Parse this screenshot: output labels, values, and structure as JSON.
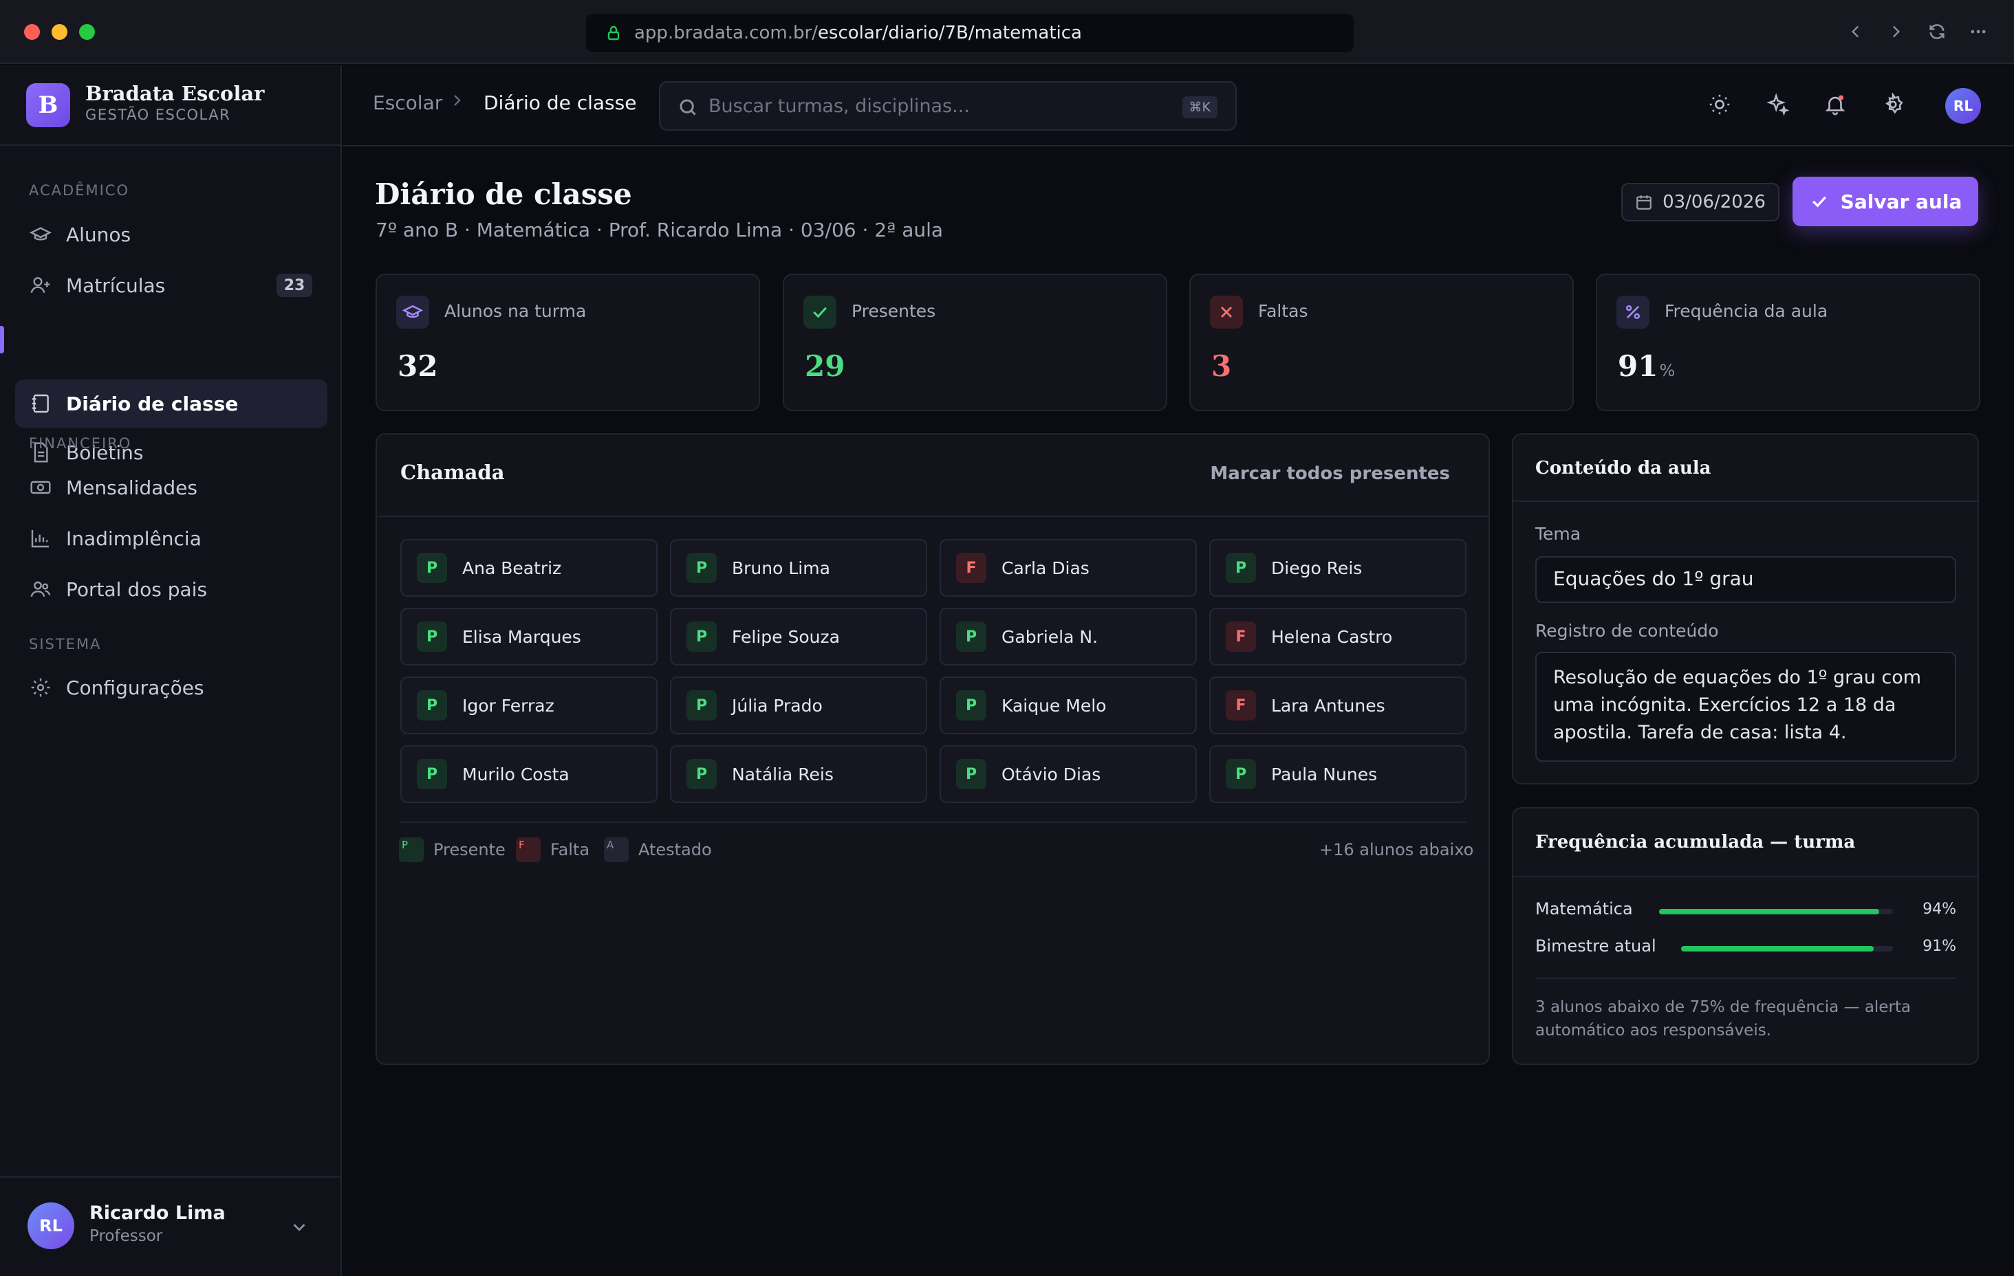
{
  "browser": {
    "url_host": "app.bradata.com.br/",
    "url_path": "escolar/diario/7B/matematica"
  },
  "sidebar": {
    "brand_letter": "B",
    "brand_name": "Bradata Escolar",
    "brand_sub": "GESTÃO ESCOLAR",
    "sections": {
      "academico": "ACADÊMICO",
      "financeiro": "FINANCEIRO",
      "sistema": "SISTEMA"
    },
    "items": {
      "alunos": "Alunos",
      "matriculas": "Matrículas",
      "matriculas_badge": "23",
      "diario": "Diário de classe",
      "boletins": "Boletins",
      "mensalidades": "Mensalidades",
      "inadimplencia": "Inadimplência",
      "portal": "Portal dos pais",
      "configuracoes": "Configurações"
    },
    "user": {
      "initials": "RL",
      "name": "Ricardo Lima",
      "role": "Professor"
    }
  },
  "topbar": {
    "breadcrumb_root": "Escolar",
    "breadcrumb_current": "Diário de classe",
    "search_placeholder": "Buscar turmas, disciplinas...",
    "search_shortcut": "⌘K",
    "avatar_initials": "RL"
  },
  "header": {
    "title": "Diário de classe",
    "subtitle": "7º ano B · Matemática · Prof. Ricardo Lima · 03/06 · 2ª aula",
    "date": "03/06/2026",
    "save_label": "Salvar aula"
  },
  "stats": {
    "alunos": {
      "label": "Alunos na turma",
      "value": "32"
    },
    "presentes": {
      "label": "Presentes",
      "value": "29"
    },
    "faltas": {
      "label": "Faltas",
      "value": "3"
    },
    "frequencia": {
      "label": "Frequência da aula",
      "value": "91",
      "unit": "%"
    }
  },
  "chamada": {
    "title": "Chamada",
    "mark_all": "Marcar todos presentes",
    "students": [
      {
        "status": "P",
        "name": "Ana Beatriz"
      },
      {
        "status": "P",
        "name": "Bruno Lima"
      },
      {
        "status": "F",
        "name": "Carla Dias"
      },
      {
        "status": "P",
        "name": "Diego Reis"
      },
      {
        "status": "P",
        "name": "Elisa Marques"
      },
      {
        "status": "P",
        "name": "Felipe Souza"
      },
      {
        "status": "P",
        "name": "Gabriela N."
      },
      {
        "status": "F",
        "name": "Helena Castro"
      },
      {
        "status": "P",
        "name": "Igor Ferraz"
      },
      {
        "status": "P",
        "name": "Júlia Prado"
      },
      {
        "status": "P",
        "name": "Kaique Melo"
      },
      {
        "status": "F",
        "name": "Lara Antunes"
      },
      {
        "status": "P",
        "name": "Murilo Costa"
      },
      {
        "status": "P",
        "name": "Natália Reis"
      },
      {
        "status": "P",
        "name": "Otávio Dias"
      },
      {
        "status": "P",
        "name": "Paula Nunes"
      }
    ],
    "legend": {
      "p_letter": "P",
      "p_label": "Presente",
      "f_letter": "F",
      "f_label": "Falta",
      "a_letter": "A",
      "a_label": "Atestado"
    },
    "more": "+16 alunos abaixo"
  },
  "conteudo": {
    "title": "Conteúdo da aula",
    "tema_label": "Tema",
    "tema_value": "Equações do 1º grau",
    "registro_label": "Registro de conteúdo",
    "registro_value": "Resolução de equações do 1º grau com uma incógnita. Exercícios 12 a 18 da apostila. Tarefa de casa: lista 4."
  },
  "frequencia": {
    "title": "Frequência acumulada — turma",
    "rows": [
      {
        "label": "Matemática",
        "value": "94%",
        "fraction": 0.94
      },
      {
        "label": "Bimestre atual",
        "value": "91%",
        "fraction": 0.91
      }
    ],
    "note": "3 alunos abaixo de 75% de frequência — alerta automático aos responsáveis."
  },
  "colors": {
    "accent": "#8b5cf6",
    "present": "#4ade80",
    "absent": "#f87171",
    "bar": "#22c55e"
  }
}
